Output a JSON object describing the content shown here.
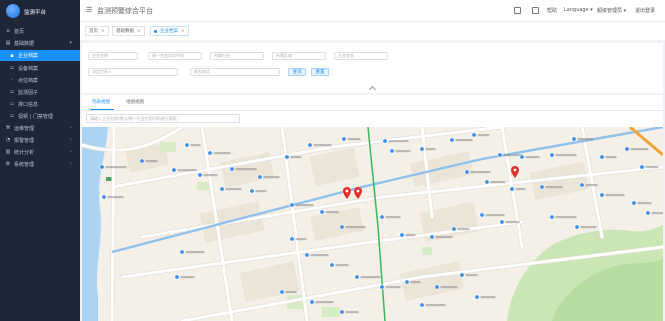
{
  "app": {
    "logo_text": "监测平台",
    "title": "监测预警综合平台"
  },
  "header": {
    "menu_icon": "hamburger-icon",
    "icons": [
      "calendar-icon",
      "fullscreen-icon"
    ],
    "help_label": "帮助",
    "language_label": "Language",
    "user_label": "超级管理员",
    "logout_label": "退出登录"
  },
  "sidebar": {
    "items": [
      {
        "label": "首页",
        "icon": "home-icon"
      },
      {
        "label": "基础数据",
        "icon": "database-icon",
        "expanded": true
      },
      {
        "label": "企业档案",
        "icon": "file-icon",
        "active": true
      },
      {
        "label": "设备档案",
        "icon": "device-icon"
      },
      {
        "label": "点位档案",
        "icon": "location-icon"
      },
      {
        "label": "监测因子",
        "icon": "factor-icon"
      },
      {
        "label": "排口信息",
        "icon": "outlet-icon"
      },
      {
        "label": "视频 | 门禁管理",
        "icon": "camera-icon"
      },
      {
        "label": "运维管理",
        "icon": "tools-icon"
      },
      {
        "label": "报警管理",
        "icon": "alarm-icon"
      },
      {
        "label": "统计分析",
        "icon": "chart-icon"
      },
      {
        "label": "系统管理",
        "icon": "settings-icon"
      }
    ]
  },
  "tabs": [
    {
      "label": "首页"
    },
    {
      "label": "基础数据"
    },
    {
      "label": "企业档案",
      "active": true
    }
  ],
  "filters": {
    "fields": [
      {
        "placeholder": "企业名称"
      },
      {
        "placeholder": "统一社会信用代码"
      },
      {
        "placeholder": "所属行业"
      },
      {
        "placeholder": "所属区域"
      },
      {
        "placeholder": "企业状态"
      },
      {
        "placeholder": "法定代表人"
      },
      {
        "placeholder": "联系电话"
      }
    ],
    "search_label": "查询",
    "reset_label": "重置"
  },
  "view_tabs": [
    {
      "label": "列表视图",
      "active": true
    },
    {
      "label": "地图视图"
    }
  ],
  "map_search": {
    "placeholder": "请输入企业名称/地址/统一社会信用代码进行搜索"
  },
  "colors": {
    "sidebar_bg": "#1e2738",
    "accent": "#1890ff",
    "marker": "#e0322c",
    "park": "#c9e6b4",
    "water": "#aad3f4",
    "metro_line": "#38b85a"
  }
}
